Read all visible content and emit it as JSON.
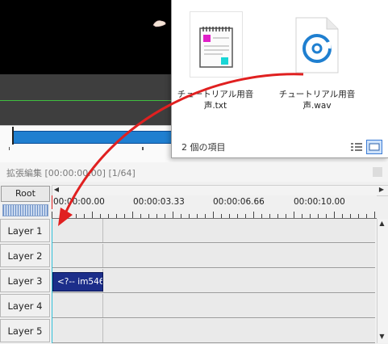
{
  "explorer": {
    "files": [
      {
        "name": "チュートリアル用音声.txt",
        "icon": "notepad-icon"
      },
      {
        "name": "チュートリアル用音声.wav",
        "icon": "audio-file-icon"
      }
    ],
    "status": "2 個の項目",
    "accent_color": "#1f7fd0"
  },
  "editor": {
    "title": "拡張編集 [00:00:00.00] [1/64]",
    "root_label": "Root",
    "time_labels": [
      "00:00:00.00",
      "00:00:03.33",
      "00:00:06.66",
      "00:00:10.00"
    ],
    "layers": [
      {
        "label": "Layer 1"
      },
      {
        "label": "Layer 2"
      },
      {
        "label": "Layer 3",
        "clip": "<?-- im546"
      },
      {
        "label": "Layer 4"
      },
      {
        "label": "Layer 5"
      }
    ],
    "clip_color": "#1c2e8a",
    "annotation_color": "#e02020"
  }
}
